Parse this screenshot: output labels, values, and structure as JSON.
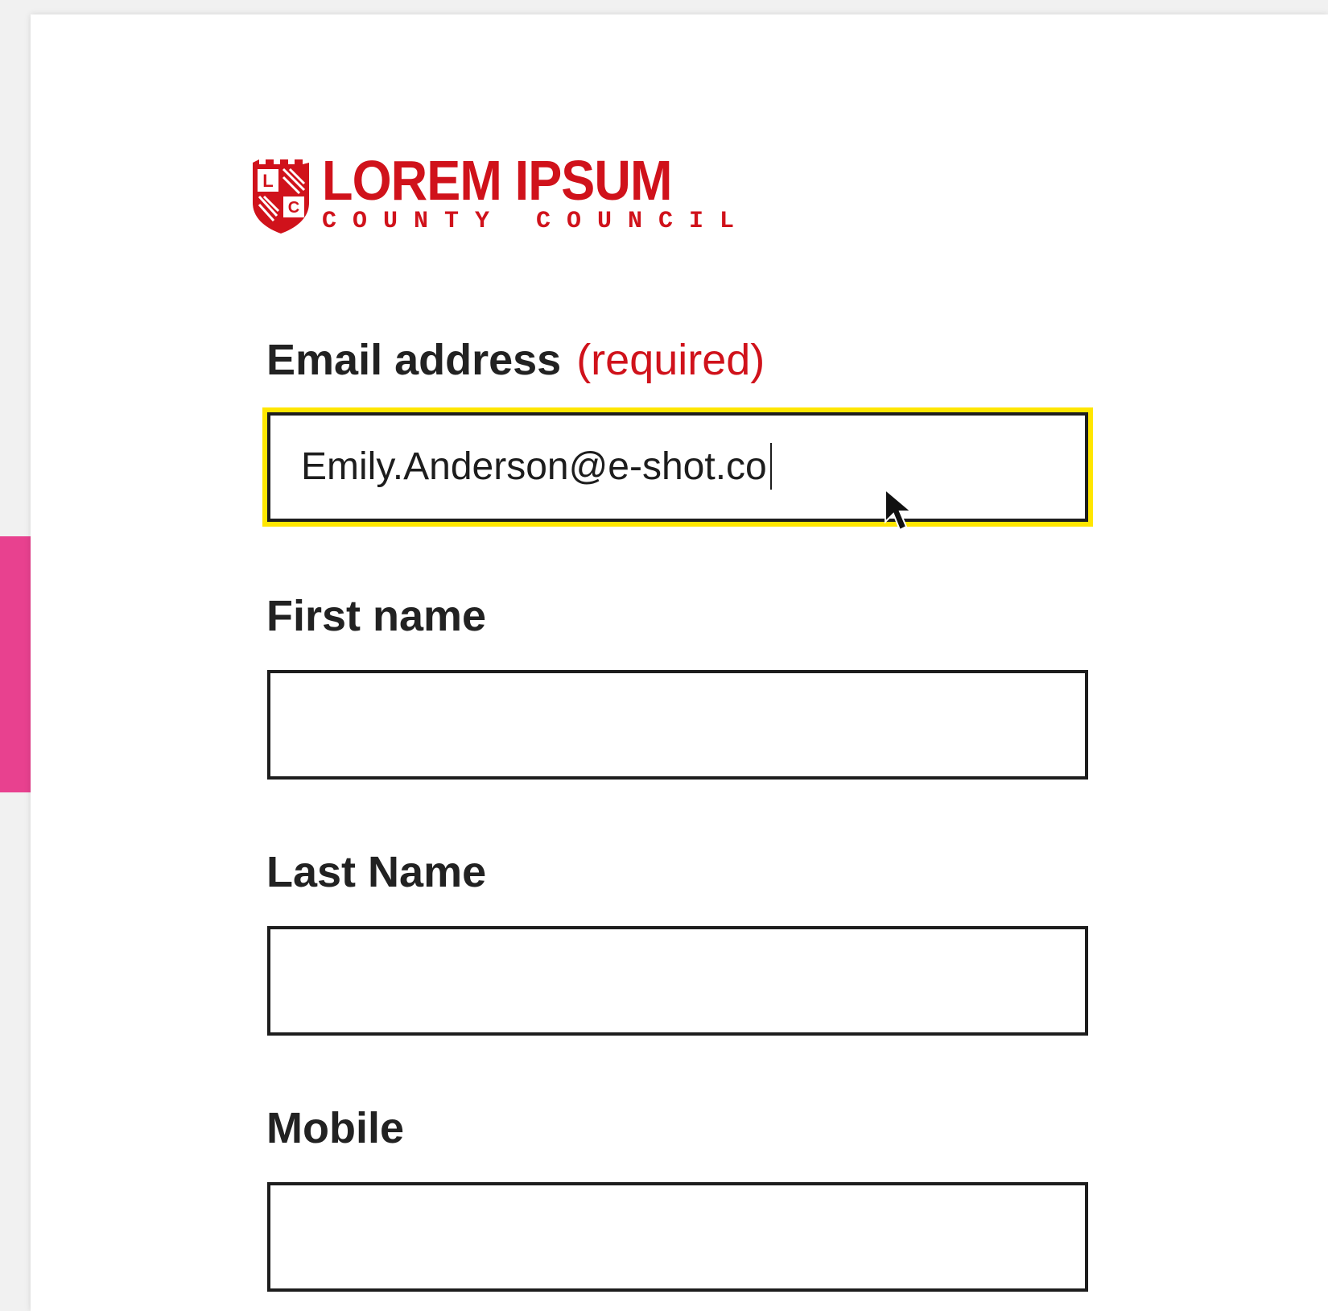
{
  "logo": {
    "title": "LOREM IPSUM",
    "subtitle": "COUNTY COUNCIL",
    "crest_letters": [
      "L",
      "C"
    ],
    "color": "#d0121b"
  },
  "form": {
    "email": {
      "label": "Email address",
      "required_text": "(required)",
      "value": "Emily.Anderson@e-shot.co"
    },
    "first_name": {
      "label": "First name",
      "value": ""
    },
    "last_name": {
      "label": "Last Name",
      "value": ""
    },
    "mobile": {
      "label": "Mobile",
      "value": ""
    }
  },
  "colors": {
    "accent_red": "#d0121b",
    "focus_outline": "#ffe600",
    "side_tab": "#e8418f"
  },
  "icons": {
    "crest": "shield-crest-icon",
    "pointer": "mouse-pointer-icon"
  }
}
